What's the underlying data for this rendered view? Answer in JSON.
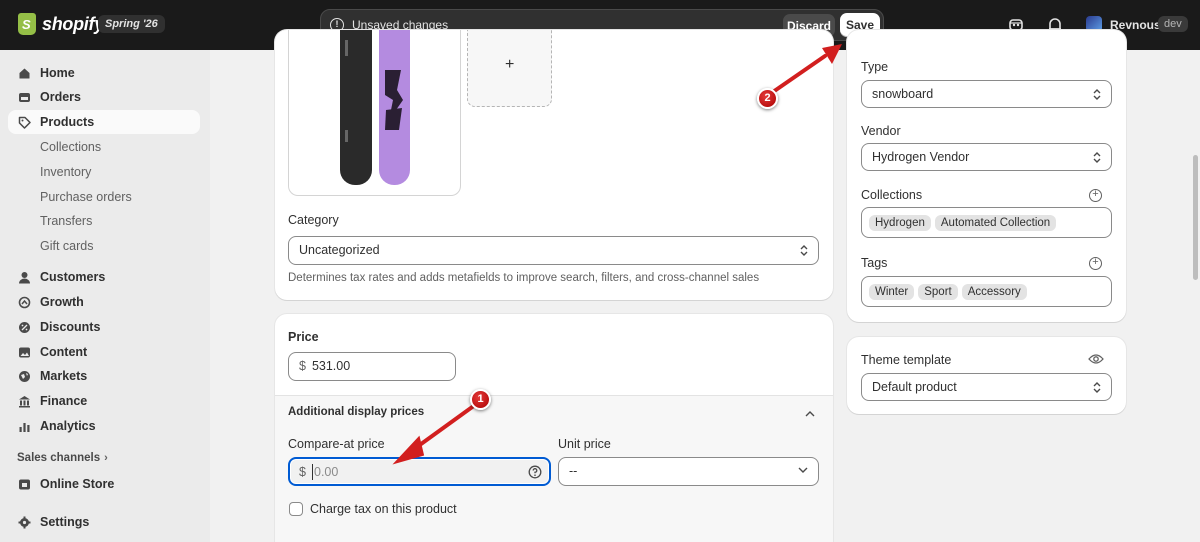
{
  "topbar": {
    "logo_text": "shopify",
    "release_badge": "Spring '26",
    "unsaved_text": "Unsaved changes",
    "discard_label": "Discard",
    "save_label": "Save",
    "store_name": "Revnous",
    "store_badge": "dev"
  },
  "sidebar": {
    "items": [
      {
        "label": "Home",
        "icon": "home-icon"
      },
      {
        "label": "Orders",
        "icon": "orders-icon"
      },
      {
        "label": "Products",
        "icon": "tag-icon"
      },
      {
        "label": "Customers",
        "icon": "person-icon"
      },
      {
        "label": "Growth",
        "icon": "growth-icon"
      },
      {
        "label": "Discounts",
        "icon": "discount-icon"
      },
      {
        "label": "Content",
        "icon": "content-icon"
      },
      {
        "label": "Markets",
        "icon": "globe-icon"
      },
      {
        "label": "Finance",
        "icon": "bank-icon"
      },
      {
        "label": "Analytics",
        "icon": "chart-icon"
      }
    ],
    "product_subitems": [
      "Collections",
      "Inventory",
      "Purchase orders",
      "Transfers",
      "Gift cards"
    ],
    "sales_channels_label": "Sales channels",
    "online_store_label": "Online Store",
    "settings_label": "Settings"
  },
  "media": {
    "add_label": "+"
  },
  "category": {
    "label": "Category",
    "value": "Uncategorized",
    "help": "Determines tax rates and adds metafields to improve search, filters, and cross-channel sales"
  },
  "pricing": {
    "title": "Price",
    "currency": "$",
    "price": "531.00",
    "additional_title": "Additional display prices",
    "compare_label": "Compare-at price",
    "compare_placeholder": "0.00",
    "unit_label": "Unit price",
    "unit_value": "--",
    "charge_tax_label": "Charge tax on this product"
  },
  "organization": {
    "type_label": "Type",
    "type_value": "snowboard",
    "vendor_label": "Vendor",
    "vendor_value": "Hydrogen Vendor",
    "collections_label": "Collections",
    "collections": [
      "Hydrogen",
      "Automated Collection"
    ],
    "tags_label": "Tags",
    "tags": [
      "Winter",
      "Sport",
      "Accessory"
    ]
  },
  "theme": {
    "label": "Theme template",
    "value": "Default product"
  },
  "annotations": [
    "1",
    "2"
  ],
  "colors": {
    "annotation_red": "#d21f1f",
    "topbar": "#1a1a1a",
    "focus_blue": "#005bd3"
  }
}
